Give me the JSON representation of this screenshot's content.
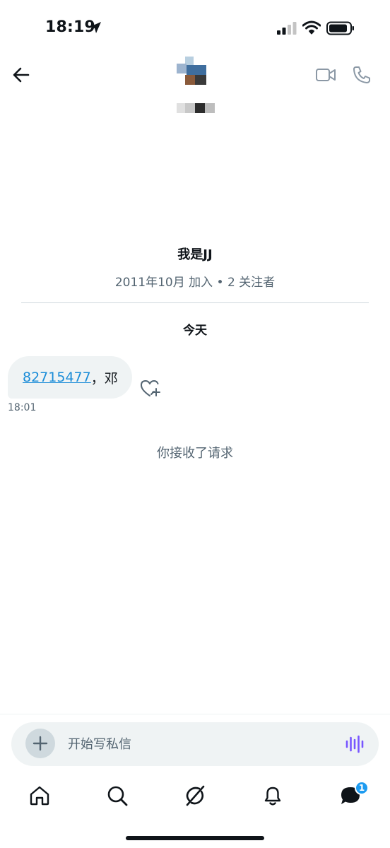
{
  "status_bar": {
    "time": "18:19"
  },
  "header": {
    "back_icon": "arrow-left-icon",
    "video_icon": "video-camera-icon",
    "phone_icon": "phone-icon"
  },
  "profile": {
    "name": "我是JJ",
    "meta": "2011年10月 加入 • 2 关注者"
  },
  "conversation": {
    "date_separator": "今天",
    "messages": [
      {
        "link_text": "82715477",
        "rest_text": "，邓",
        "time": "18:01"
      }
    ],
    "system_message": "你接收了请求"
  },
  "composer": {
    "placeholder": "开始写私信"
  },
  "tab_bar": {
    "items": [
      "home-icon",
      "search-icon",
      "grok-icon",
      "bell-icon",
      "messages-icon"
    ],
    "messages_badge": "1"
  },
  "colors": {
    "accent": "#1d9bf0",
    "link": "#1a8cd8",
    "secondary_text": "#536471",
    "bubble_bg": "#eff3f4",
    "voice_icon": "#7856ff"
  }
}
